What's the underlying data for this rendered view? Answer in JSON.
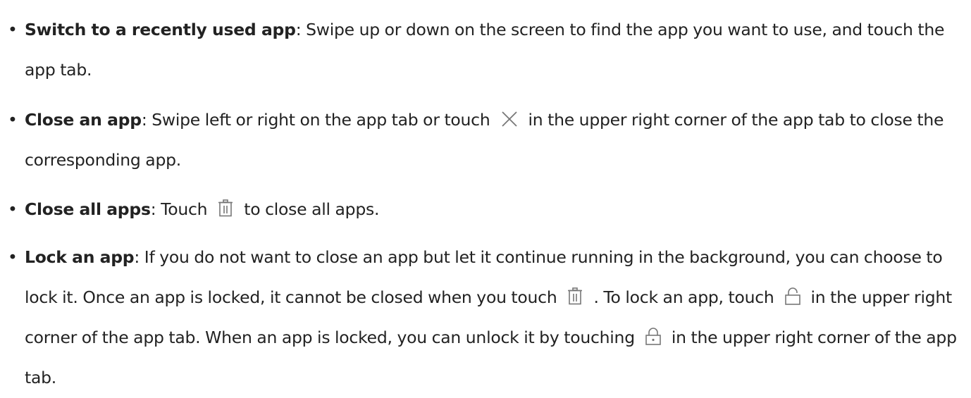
{
  "bullet_glyph": "•",
  "items": [
    {
      "bold": "Switch to a recently used app",
      "text": ": Swipe up or down on the screen to find the app you want to use, and touch the app tab."
    },
    {
      "bold": "Close an app",
      "text_before": ": Swipe left or right on the app tab or touch",
      "icon": "close-x-icon",
      "text_after": "in the upper right corner of the app tab to close the corresponding app."
    },
    {
      "bold": "Close all apps",
      "text_before": ": Touch",
      "icon": "trash-icon",
      "text_after": "to close all apps."
    },
    {
      "bold": "Lock an app",
      "text_1": ": If you do not want to close an app but let it continue running in the background, you can choose to lock it. Once an app is locked, it cannot be closed when you touch",
      "icon_1": "trash-icon",
      "text_2": ". To lock an app, touch",
      "icon_2": "unlocked-padlock-icon",
      "text_3": "in the upper right corner of the app tab. When an app is locked, you can unlock it by touching",
      "icon_3": "locked-padlock-icon",
      "text_4": "in the upper right corner of the app tab."
    }
  ]
}
